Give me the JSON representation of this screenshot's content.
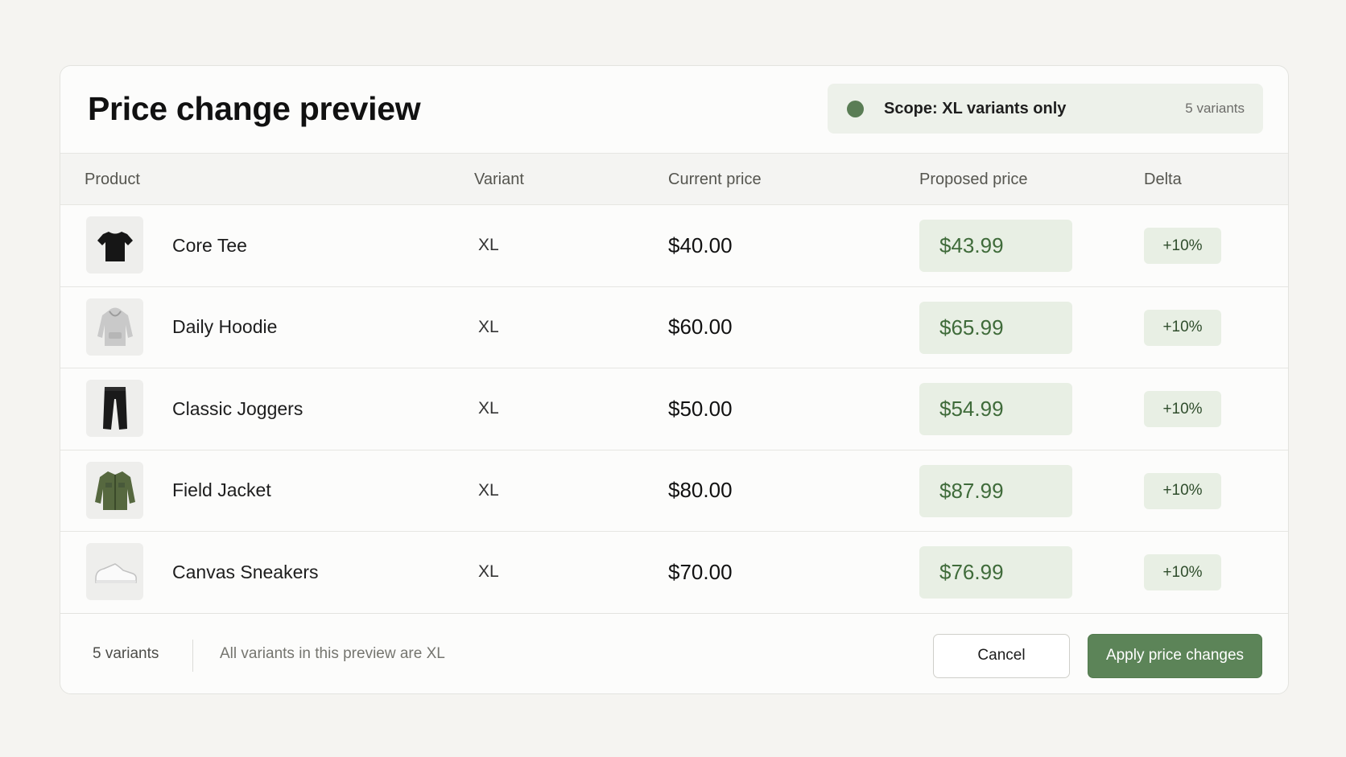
{
  "header": {
    "title": "Price change preview",
    "scope_label": "Scope: XL variants only",
    "scope_count": "5 variants",
    "scope_dot_color": "#5a7d55"
  },
  "table": {
    "columns": {
      "product": "Product",
      "variant": "Variant",
      "current": "Current price",
      "proposed": "Proposed price",
      "delta": "Delta"
    },
    "rows": [
      {
        "product": "Core Tee",
        "thumb_icon": "tshirt-icon",
        "variant": "XL",
        "current": "$40.00",
        "proposed": "$43.99",
        "delta": "+10%"
      },
      {
        "product": "Daily Hoodie",
        "thumb_icon": "hoodie-icon",
        "variant": "XL",
        "current": "$60.00",
        "proposed": "$65.99",
        "delta": "+10%"
      },
      {
        "product": "Classic Joggers",
        "thumb_icon": "joggers-icon",
        "variant": "XL",
        "current": "$50.00",
        "proposed": "$54.99",
        "delta": "+10%"
      },
      {
        "product": "Field Jacket",
        "thumb_icon": "jacket-icon",
        "variant": "XL",
        "current": "$80.00",
        "proposed": "$87.99",
        "delta": "+10%"
      },
      {
        "product": "Canvas Sneakers",
        "thumb_icon": "sneaker-icon",
        "variant": "XL",
        "current": "$70.00",
        "proposed": "$76.99",
        "delta": "+10%"
      }
    ]
  },
  "footer": {
    "count": "5 variants",
    "note": "All variants in this preview are XL",
    "cancel_label": "Cancel",
    "apply_label": "Apply price changes"
  },
  "colors": {
    "accent": "#5c8458",
    "proposed_bg": "#e8efe4",
    "proposed_text": "#3f6b3a",
    "page_bg": "#f5f4f1"
  }
}
